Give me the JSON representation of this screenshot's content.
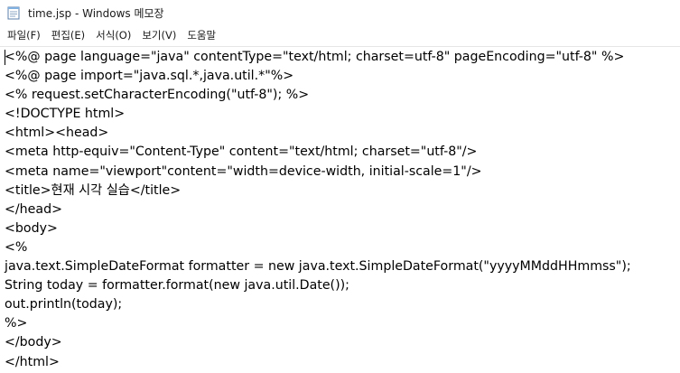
{
  "window": {
    "title": "time.jsp - Windows 메모장",
    "icon": "notepad-icon"
  },
  "menu": [
    {
      "label": "파일(F)"
    },
    {
      "label": "편집(E)"
    },
    {
      "label": "서식(O)"
    },
    {
      "label": "보기(V)"
    },
    {
      "label": "도움말"
    }
  ],
  "editor": {
    "lines": [
      "<%@ page language=\"java\" contentType=\"text/html; charset=utf-8\" pageEncoding=\"utf-8\" %>",
      "<%@ page import=\"java.sql.*,java.util.*\"%>",
      "<% request.setCharacterEncoding(\"utf-8\"); %>",
      "<!DOCTYPE html>",
      "<html><head>",
      "<meta http-equiv=\"Content-Type\" content=\"text/html; charset=\"utf-8\"/>",
      "<meta name=\"viewport\"content=\"width=device-width, initial-scale=1\"/>",
      "<title>현재 시각 실습</title>",
      "</head>",
      "<body>",
      "<%",
      "java.text.SimpleDateFormat formatter = new java.text.SimpleDateFormat(\"yyyyMMddHHmmss\");",
      "String today = formatter.format(new java.util.Date());",
      "out.println(today);",
      "%>",
      "</body>",
      "</html>"
    ]
  }
}
